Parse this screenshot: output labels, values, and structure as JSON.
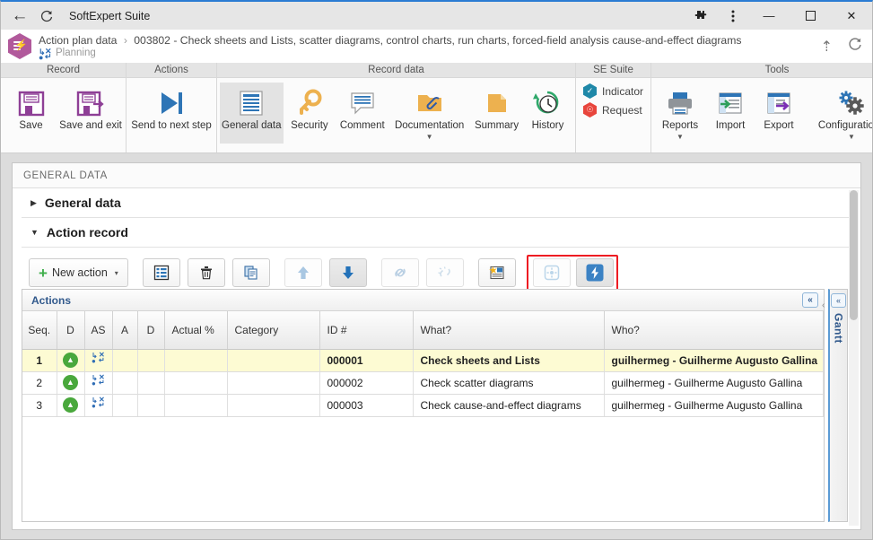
{
  "window": {
    "title": "SoftExpert Suite",
    "back_icon": "back-arrow-icon",
    "reload_icon": "reload-icon",
    "puzzle_icon": "extensions-icon",
    "kebab_icon": "more-options-icon",
    "minimize_label": "—",
    "maximize_label": "☐",
    "close_label": "✕"
  },
  "breadcrumb": {
    "root": "Action plan data",
    "separator": "›",
    "current": "003802 - Check sheets and Lists, scatter diagrams, control charts, run charts, forced-field analysis cause-and-effect diagrams",
    "status": "Planning",
    "collapse_icon": "chevron-double-up-icon",
    "refresh_icon": "refresh-icon"
  },
  "ribbon": {
    "groups": [
      {
        "title": "Record",
        "buttons": [
          {
            "label": "Save",
            "icon": "save-icon"
          },
          {
            "label": "Save and exit",
            "icon": "save-and-exit-icon"
          }
        ]
      },
      {
        "title": "Actions",
        "buttons": [
          {
            "label": "Send to next step",
            "icon": "send-next-step-icon"
          }
        ]
      },
      {
        "title": "Record data",
        "buttons": [
          {
            "label": "General data",
            "icon": "general-data-icon",
            "selected": true
          },
          {
            "label": "Security",
            "icon": "key-icon"
          },
          {
            "label": "Comment",
            "icon": "comment-icon"
          },
          {
            "label": "Documentation",
            "icon": "documentation-icon",
            "caret": "▼"
          },
          {
            "label": "Summary",
            "icon": "summary-icon"
          },
          {
            "label": "History",
            "icon": "history-clock-icon"
          }
        ]
      },
      {
        "title": "SE Suite",
        "buttons": [
          {
            "label": "Indicator",
            "icon": "indicator-icon"
          },
          {
            "label": "Request",
            "icon": "request-icon"
          }
        ]
      },
      {
        "title": "Tools",
        "buttons": [
          {
            "label": "Reports",
            "icon": "printer-icon",
            "caret": "▼"
          },
          {
            "label": "Import",
            "icon": "import-icon"
          },
          {
            "label": "Export",
            "icon": "export-icon"
          },
          {
            "label": "Configurations",
            "icon": "gears-icon",
            "caret": "▼"
          }
        ]
      }
    ]
  },
  "panel": {
    "header": "GENERAL DATA",
    "sections": [
      {
        "label": "General data",
        "expanded": false,
        "tri": "▶"
      },
      {
        "label": "Action record",
        "expanded": true,
        "tri": "▼"
      }
    ]
  },
  "action_toolbar": {
    "new_action_label": "New action",
    "new_action_plus": "+",
    "new_action_caret": "▾",
    "buttons": [
      {
        "name": "details-button",
        "icon": "list-details-icon",
        "state": "enabled"
      },
      {
        "name": "delete-button",
        "icon": "trash-icon",
        "state": "enabled"
      },
      {
        "name": "copy-button",
        "icon": "copy-icon",
        "state": "enabled"
      },
      {
        "name": "move-up-button",
        "icon": "arrow-up-icon",
        "state": "disabled"
      },
      {
        "name": "move-down-button",
        "icon": "arrow-down-icon",
        "state": "pressed"
      },
      {
        "name": "link-button",
        "icon": "link-icon",
        "state": "disabled"
      },
      {
        "name": "unlink-button",
        "icon": "unlink-icon",
        "state": "disabled"
      },
      {
        "name": "import-actions-button",
        "icon": "import-actions-icon",
        "state": "enabled"
      }
    ],
    "highlighted_buttons": [
      {
        "name": "reorder-button",
        "icon": "move-crosshair-icon",
        "state": "disabled"
      },
      {
        "name": "quick-action-button",
        "icon": "lightning-bolt-icon",
        "state": "active"
      }
    ],
    "highlight_color": "#ee1c23"
  },
  "grid": {
    "title": "Actions",
    "collapse_icon": "«",
    "columns": [
      {
        "key": "seq",
        "label": "Seq.",
        "align": "center"
      },
      {
        "key": "d1",
        "label": "D",
        "align": "center"
      },
      {
        "key": "as",
        "label": "AS",
        "align": "center"
      },
      {
        "key": "a",
        "label": "A",
        "align": "center"
      },
      {
        "key": "d2",
        "label": "D",
        "align": "center"
      },
      {
        "key": "actual",
        "label": "Actual %",
        "align": "left"
      },
      {
        "key": "category",
        "label": "Category",
        "align": "left"
      },
      {
        "key": "id",
        "label": "ID #",
        "align": "left"
      },
      {
        "key": "what",
        "label": "What?",
        "align": "left"
      },
      {
        "key": "who",
        "label": "Who?",
        "align": "left"
      }
    ],
    "rows": [
      {
        "seq": "1",
        "d1": "status-on-time",
        "as": "flow-icon",
        "a": "",
        "d2": "",
        "actual": "",
        "category": "",
        "id": "000001",
        "what": "Check sheets and Lists",
        "who": "guilhermeg - Guilherme Augusto Gallina",
        "selected": true
      },
      {
        "seq": "2",
        "d1": "status-on-time",
        "as": "flow-icon",
        "a": "",
        "d2": "",
        "actual": "",
        "category": "",
        "id": "000002",
        "what": "Check scatter diagrams",
        "who": "guilhermeg - Guilherme Augusto Gallina",
        "selected": false
      },
      {
        "seq": "3",
        "d1": "status-on-time",
        "as": "flow-icon",
        "a": "",
        "d2": "",
        "actual": "",
        "category": "",
        "id": "000003",
        "what": "Check cause-and-effect diagrams",
        "who": "guilhermeg - Guilherme Augusto Gallina",
        "selected": false
      }
    ]
  },
  "gantt": {
    "label": "Gantt",
    "collapse_icon": "«",
    "arrow_icon": "‹"
  },
  "colors": {
    "accent_blue": "#2b7cd3",
    "logo_purple": "#b1599b",
    "status_green": "#49a83c",
    "highlight_red": "#ee1c23",
    "selected_row": "#fdfbd3",
    "link_blue": "#31598c"
  }
}
